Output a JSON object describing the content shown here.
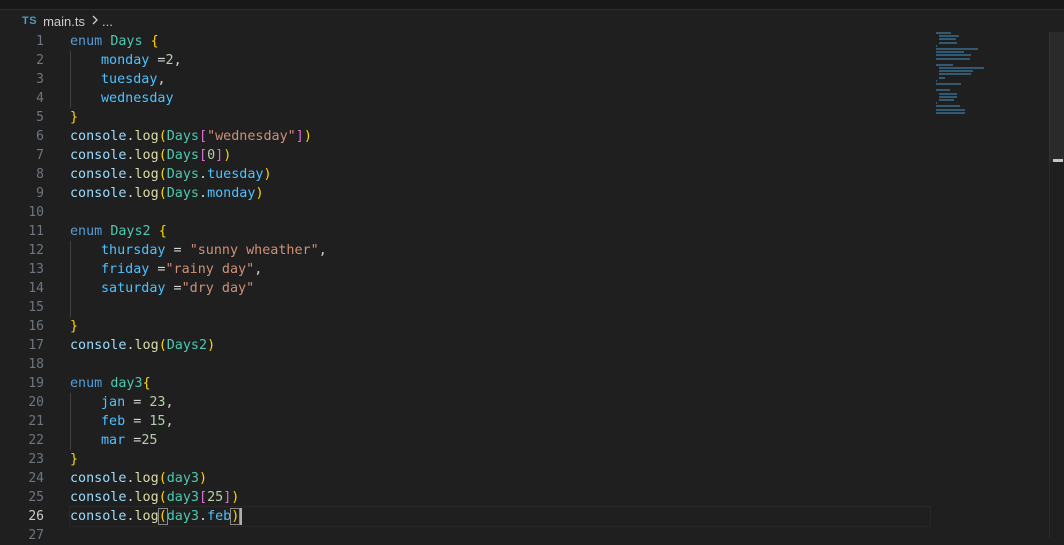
{
  "breadcrumb": {
    "file_icon_text": "TS",
    "file_name": "main.ts",
    "separator_icon": "chevron-right-icon",
    "more": "..."
  },
  "editor": {
    "cursor_line": 26,
    "lines": [
      {
        "n": 1,
        "tokens": [
          [
            "kw",
            "enum"
          ],
          [
            "op",
            " "
          ],
          [
            "ty",
            "Days"
          ],
          [
            "op",
            " "
          ],
          [
            "p1",
            "{"
          ]
        ]
      },
      {
        "n": 2,
        "indent": 1,
        "tokens": [
          [
            "pr",
            "monday"
          ],
          [
            "op",
            " ="
          ],
          [
            "nm",
            "2"
          ],
          [
            "op",
            ","
          ]
        ]
      },
      {
        "n": 3,
        "indent": 1,
        "tokens": [
          [
            "pr",
            "tuesday"
          ],
          [
            "op",
            ","
          ]
        ]
      },
      {
        "n": 4,
        "indent": 1,
        "tokens": [
          [
            "pr",
            "wednesday"
          ]
        ]
      },
      {
        "n": 5,
        "tokens": [
          [
            "p1",
            "}"
          ]
        ]
      },
      {
        "n": 6,
        "tokens": [
          [
            "vr",
            "console"
          ],
          [
            "op",
            "."
          ],
          [
            "fn",
            "log"
          ],
          [
            "p1",
            "("
          ],
          [
            "ty",
            "Days"
          ],
          [
            "p2",
            "["
          ],
          [
            "st",
            "\"wednesday\""
          ],
          [
            "p2",
            "]"
          ],
          [
            "p1",
            ")"
          ]
        ]
      },
      {
        "n": 7,
        "tokens": [
          [
            "vr",
            "console"
          ],
          [
            "op",
            "."
          ],
          [
            "fn",
            "log"
          ],
          [
            "p1",
            "("
          ],
          [
            "ty",
            "Days"
          ],
          [
            "p2",
            "["
          ],
          [
            "nm",
            "0"
          ],
          [
            "p2",
            "]"
          ],
          [
            "p1",
            ")"
          ]
        ]
      },
      {
        "n": 8,
        "tokens": [
          [
            "vr",
            "console"
          ],
          [
            "op",
            "."
          ],
          [
            "fn",
            "log"
          ],
          [
            "p1",
            "("
          ],
          [
            "ty",
            "Days"
          ],
          [
            "op",
            "."
          ],
          [
            "pr",
            "tuesday"
          ],
          [
            "p1",
            ")"
          ]
        ]
      },
      {
        "n": 9,
        "tokens": [
          [
            "vr",
            "console"
          ],
          [
            "op",
            "."
          ],
          [
            "fn",
            "log"
          ],
          [
            "p1",
            "("
          ],
          [
            "ty",
            "Days"
          ],
          [
            "op",
            "."
          ],
          [
            "pr",
            "monday"
          ],
          [
            "p1",
            ")"
          ]
        ]
      },
      {
        "n": 10,
        "tokens": []
      },
      {
        "n": 11,
        "tokens": [
          [
            "kw",
            "enum"
          ],
          [
            "op",
            " "
          ],
          [
            "ty",
            "Days2"
          ],
          [
            "op",
            " "
          ],
          [
            "p1",
            "{"
          ]
        ]
      },
      {
        "n": 12,
        "indent": 1,
        "tokens": [
          [
            "pr",
            "thursday"
          ],
          [
            "op",
            " = "
          ],
          [
            "st",
            "\"sunny wheather\""
          ],
          [
            "op",
            ","
          ]
        ]
      },
      {
        "n": 13,
        "indent": 1,
        "tokens": [
          [
            "pr",
            "friday"
          ],
          [
            "op",
            " ="
          ],
          [
            "st",
            "\"rainy day\""
          ],
          [
            "op",
            ","
          ]
        ]
      },
      {
        "n": 14,
        "indent": 1,
        "tokens": [
          [
            "pr",
            "saturday"
          ],
          [
            "op",
            " ="
          ],
          [
            "st",
            "\"dry day\""
          ]
        ]
      },
      {
        "n": 15,
        "indent": 1,
        "tokens": []
      },
      {
        "n": 16,
        "tokens": [
          [
            "p1",
            "}"
          ]
        ]
      },
      {
        "n": 17,
        "tokens": [
          [
            "vr",
            "console"
          ],
          [
            "op",
            "."
          ],
          [
            "fn",
            "log"
          ],
          [
            "p1",
            "("
          ],
          [
            "ty",
            "Days2"
          ],
          [
            "p1",
            ")"
          ]
        ]
      },
      {
        "n": 18,
        "tokens": []
      },
      {
        "n": 19,
        "tokens": [
          [
            "kw",
            "enum"
          ],
          [
            "op",
            " "
          ],
          [
            "ty",
            "day3"
          ],
          [
            "p1",
            "{"
          ]
        ]
      },
      {
        "n": 20,
        "indent": 1,
        "tokens": [
          [
            "pr",
            "jan"
          ],
          [
            "op",
            " = "
          ],
          [
            "nm",
            "23"
          ],
          [
            "op",
            ","
          ]
        ]
      },
      {
        "n": 21,
        "indent": 1,
        "tokens": [
          [
            "pr",
            "feb"
          ],
          [
            "op",
            " = "
          ],
          [
            "nm",
            "15"
          ],
          [
            "op",
            ","
          ]
        ]
      },
      {
        "n": 22,
        "indent": 1,
        "tokens": [
          [
            "pr",
            "mar"
          ],
          [
            "op",
            " ="
          ],
          [
            "nm",
            "25"
          ]
        ]
      },
      {
        "n": 23,
        "tokens": [
          [
            "p1",
            "}"
          ]
        ]
      },
      {
        "n": 24,
        "tokens": [
          [
            "vr",
            "console"
          ],
          [
            "op",
            "."
          ],
          [
            "fn",
            "log"
          ],
          [
            "p1",
            "("
          ],
          [
            "ty",
            "day3"
          ],
          [
            "p1",
            ")"
          ]
        ]
      },
      {
        "n": 25,
        "tokens": [
          [
            "vr",
            "console"
          ],
          [
            "op",
            "."
          ],
          [
            "fn",
            "log"
          ],
          [
            "p1",
            "("
          ],
          [
            "ty",
            "day3"
          ],
          [
            "p2",
            "["
          ],
          [
            "nm",
            "25"
          ],
          [
            "p2",
            "]"
          ],
          [
            "p1",
            ")"
          ]
        ]
      },
      {
        "n": 26,
        "tokens": [
          [
            "vr",
            "console"
          ],
          [
            "op",
            "."
          ],
          [
            "fn",
            "log"
          ],
          [
            "p1",
            "("
          ],
          [
            "ty",
            "day3"
          ],
          [
            "op",
            "."
          ],
          [
            "pr",
            "feb"
          ],
          [
            "p1",
            ")"
          ]
        ]
      },
      {
        "n": 27,
        "tokens": []
      }
    ]
  },
  "colors": {
    "background": "#1f1f1f",
    "keyword": "#569cd6",
    "type": "#4ec9b0",
    "property": "#4fc1ff",
    "function": "#dcdcaa",
    "number": "#b5cea8",
    "string": "#ce9178",
    "bracket_level1": "#ffd700",
    "bracket_level2": "#da70d6"
  }
}
